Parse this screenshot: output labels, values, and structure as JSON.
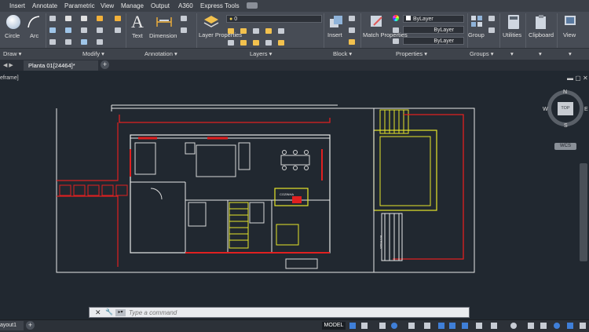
{
  "menu": {
    "items": [
      "Insert",
      "Annotate",
      "Parametric",
      "View",
      "Manage",
      "Output",
      "A360",
      "Express Tools"
    ]
  },
  "ribbon": {
    "draw": {
      "circle": "Circle",
      "arc": "Arc",
      "title": "Draw"
    },
    "modify": {
      "title": "Modify"
    },
    "annotation": {
      "text": "Text",
      "dimension": "Dimension",
      "title": "Annotation"
    },
    "layers": {
      "layer_properties": "Layer Properties",
      "current_layer": "0",
      "title": "Layers"
    },
    "block": {
      "insert": "Insert",
      "title": "Block"
    },
    "properties": {
      "match": "Match Properties",
      "color": "ByLayer",
      "linetype": "ByLayer",
      "lineweight": "ByLayer",
      "title": "Properties"
    },
    "groups": {
      "group": "Group",
      "title": "Groups"
    },
    "utilities": "Utilities",
    "clipboard": "Clipboard",
    "view": "View"
  },
  "tabs": {
    "file": "Planta 01[24464]*"
  },
  "viewport": {
    "label": "eframe]",
    "viewcube_top": "TOP",
    "compass_n": "N",
    "compass_s": "S",
    "compass_e": "E",
    "compass_w": "W",
    "wcs": "WCS"
  },
  "drawing": {
    "room_label": "COZINHA",
    "side_label": "ENTRADA"
  },
  "command": {
    "placeholder": "Type a command"
  },
  "status": {
    "layout_tab": "ayout1",
    "model": "MODEL"
  },
  "colors": {
    "ribbon": "#474c55",
    "canvas": "#212830",
    "wall": "#ffffff",
    "red": "#e02020",
    "yellow": "#e6e62a"
  }
}
